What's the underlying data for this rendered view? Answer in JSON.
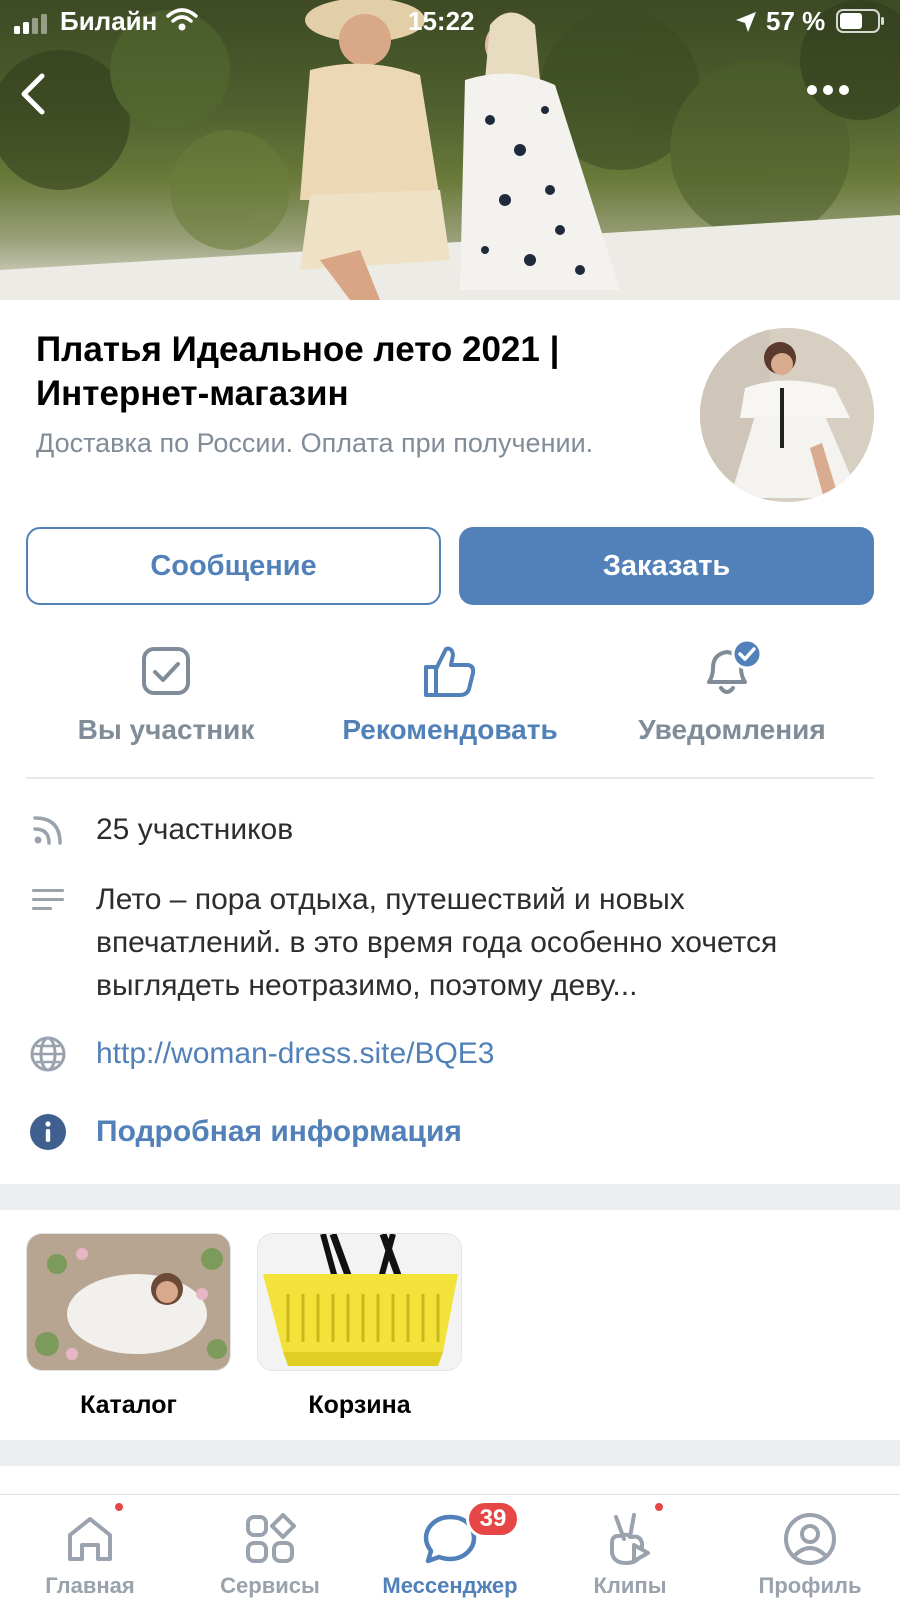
{
  "status_bar": {
    "carrier": "Билайн",
    "time": "15:22",
    "battery": "57 %"
  },
  "group": {
    "title": "Платья Идеальное лето 2021 | Интернет-магазин",
    "status": "Доставка по России. Оплата при получении."
  },
  "buttons": {
    "message": "Сообщение",
    "order": "Заказать"
  },
  "actions": [
    {
      "label": "Вы участник",
      "icon": "checkbox-icon"
    },
    {
      "label": "Рекомендовать",
      "icon": "thumbs-up-icon"
    },
    {
      "label": "Уведомления",
      "icon": "bell-check-icon"
    }
  ],
  "info": {
    "members": "25 участников",
    "description": "Лето – пора отдыха, путешествий и новых впечатлений. в это время года особенно хочется выглядеть неотразимо, поэтому деву...",
    "link": "http://woman-dress.site/BQE3",
    "details": "Подробная информация"
  },
  "apps": [
    {
      "label": "Каталог"
    },
    {
      "label": "Корзина"
    }
  ],
  "tabbar": {
    "items": [
      {
        "label": "Главная",
        "icon": "home-icon"
      },
      {
        "label": "Сервисы",
        "icon": "services-icon"
      },
      {
        "label": "Мессенджер",
        "icon": "messenger-icon"
      },
      {
        "label": "Клипы",
        "icon": "clips-icon"
      },
      {
        "label": "Профиль",
        "icon": "profile-icon"
      }
    ],
    "messenger_badge": "39"
  },
  "colors": {
    "accent": "#5181b8",
    "secondary_text": "#818c99",
    "badge": "#e64646"
  }
}
